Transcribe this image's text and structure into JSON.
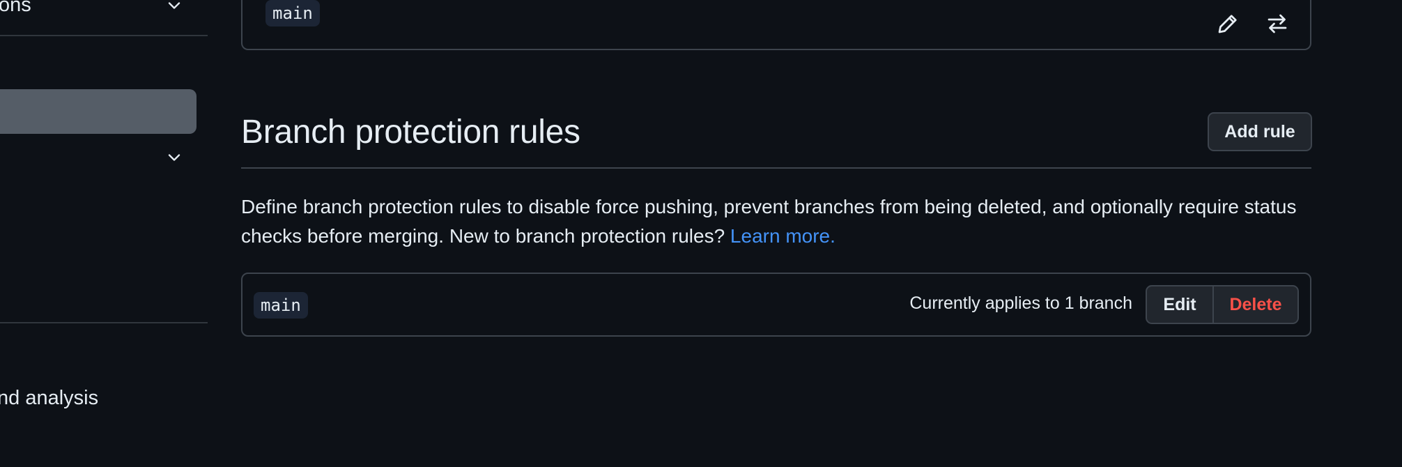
{
  "sidebar": {
    "item_top_label": "ons",
    "item_bottom_label": "nd analysis"
  },
  "top_box": {
    "branch_name": "main",
    "edit_icon": "pencil-icon",
    "rename_icon": "arrow-switch-icon"
  },
  "section": {
    "title": "Branch protection rules",
    "add_rule_label": "Add rule",
    "description": "Define branch protection rules to disable force pushing, prevent branches from being deleted, and optionally require status checks before merging. New to branch protection rules?",
    "learn_more_label": "Learn more."
  },
  "rules": [
    {
      "pattern": "main",
      "applies_text": "Currently applies to 1 branch",
      "edit_label": "Edit",
      "delete_label": "Delete"
    }
  ],
  "colors": {
    "background": "#0d1117",
    "link": "#4493f8",
    "danger": "#f85149",
    "border": "#3d444d"
  }
}
